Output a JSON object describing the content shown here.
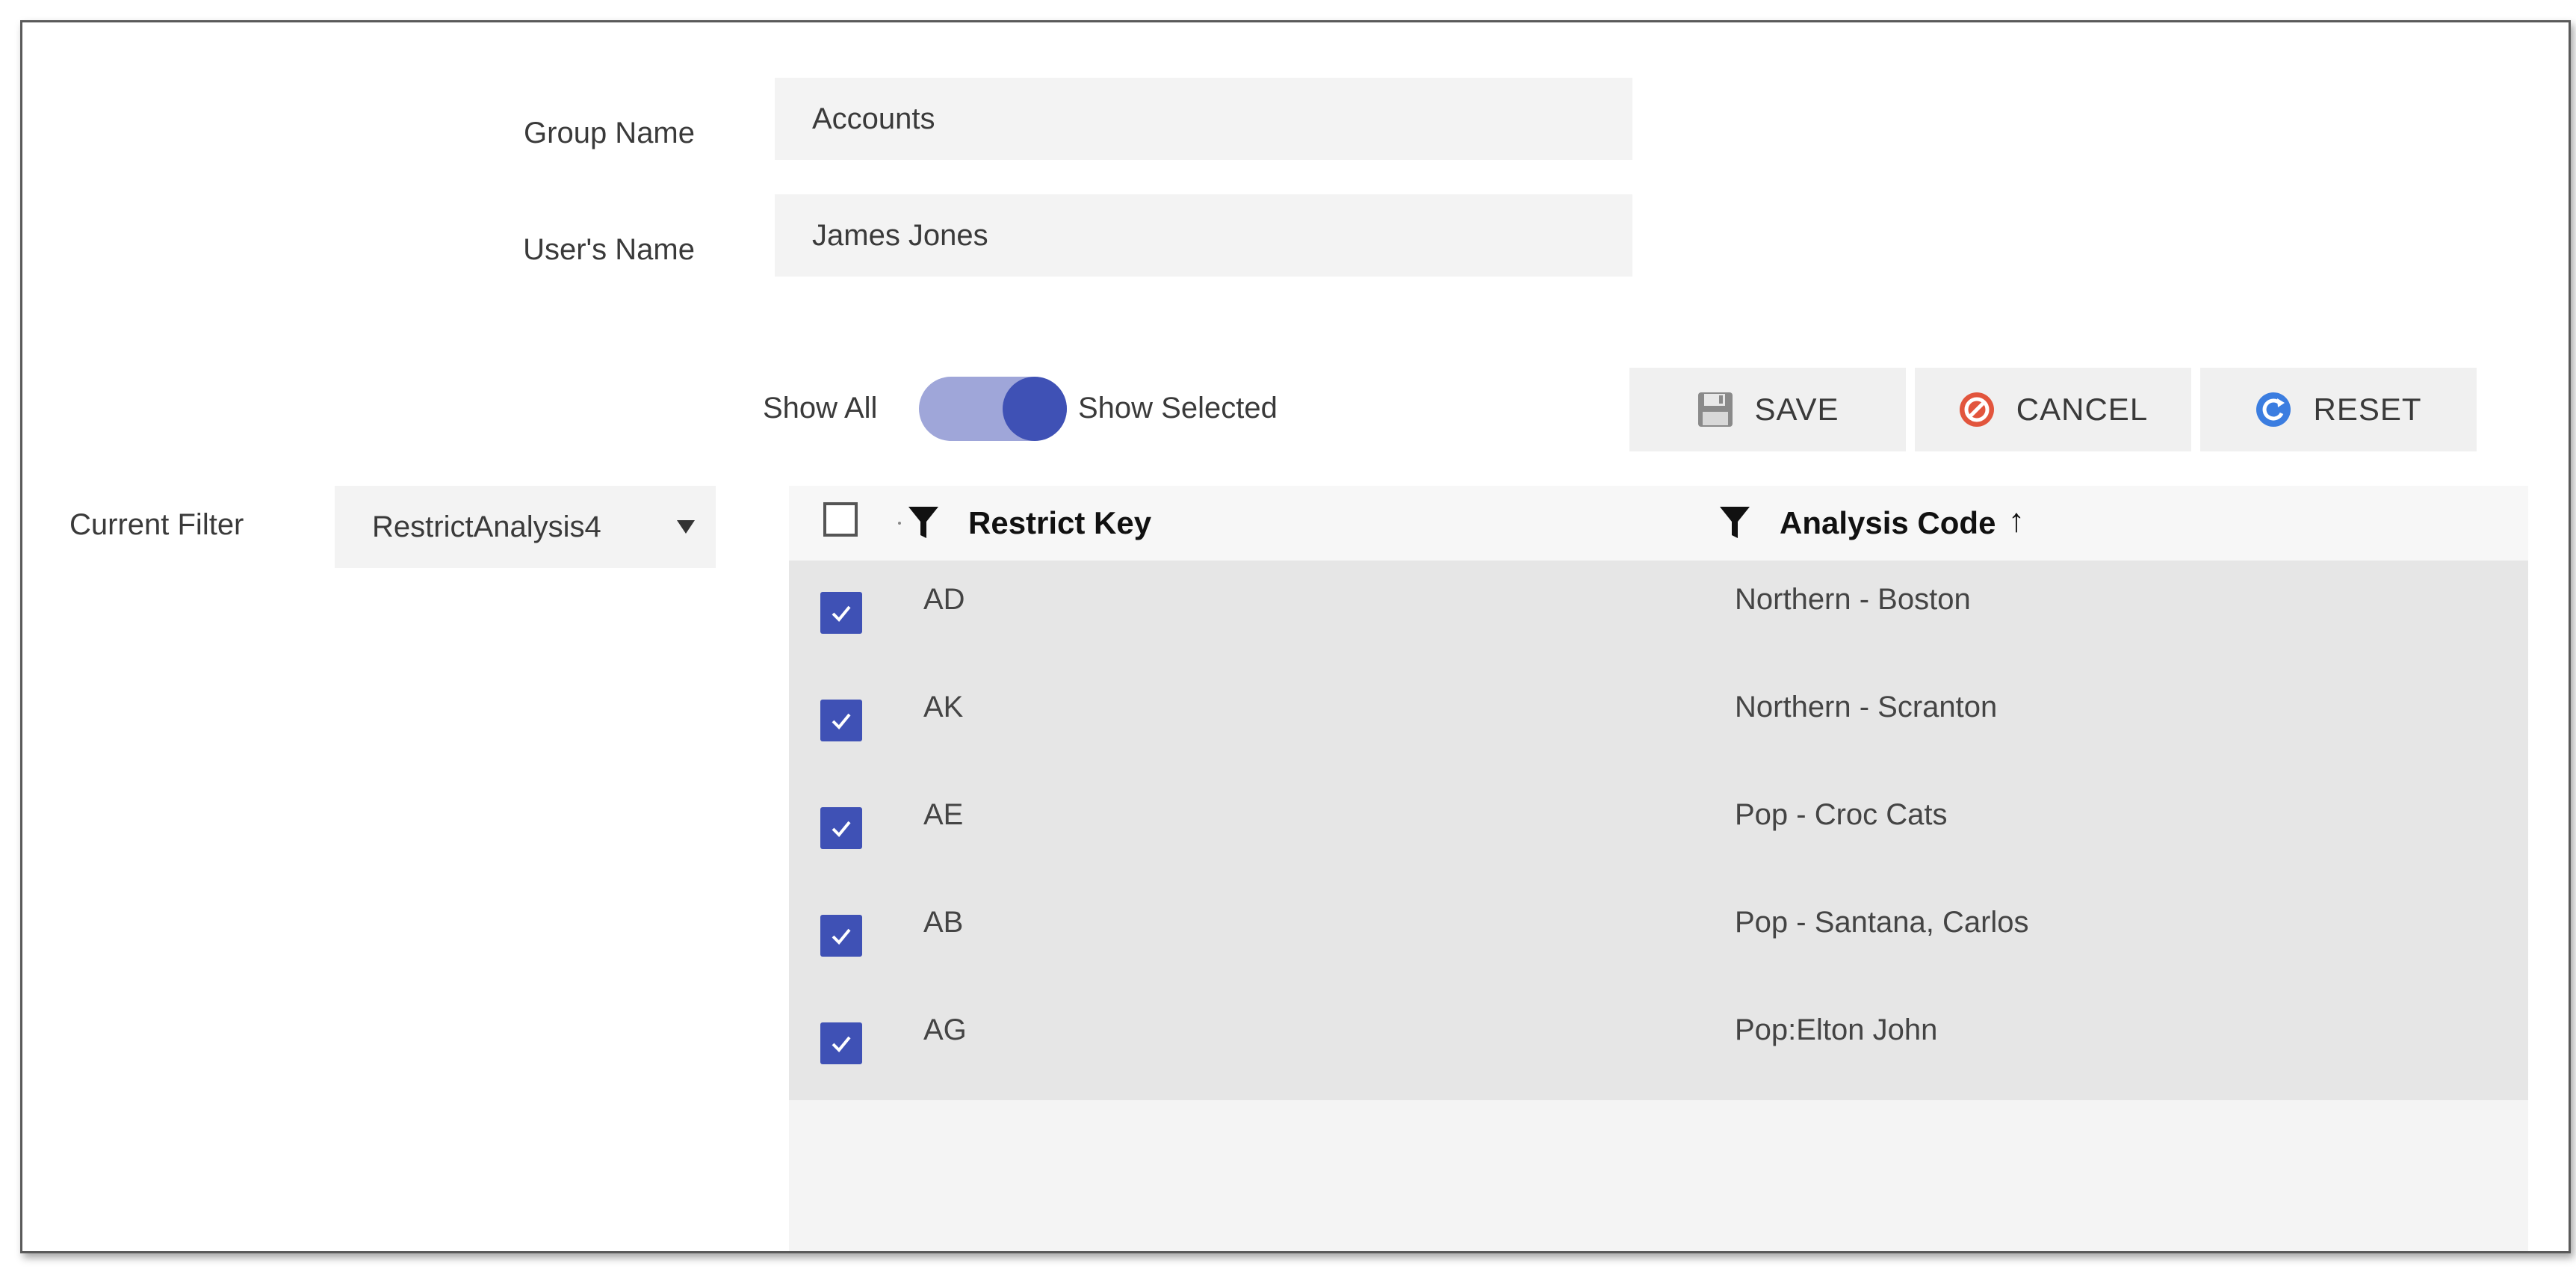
{
  "form": {
    "group_name_label": "Group Name",
    "group_name_value": "Accounts",
    "users_name_label": "User's Name",
    "users_name_value": "James Jones"
  },
  "toggle": {
    "left_label": "Show All",
    "right_label": "Show Selected",
    "state": "Show Selected"
  },
  "buttons": {
    "save_label": "SAVE",
    "cancel_label": "CANCEL",
    "reset_label": "RESET"
  },
  "filter": {
    "label": "Current Filter",
    "selected": "RestrictAnalysis4"
  },
  "grid": {
    "columns": [
      "Restrict Key",
      "Analysis Code"
    ],
    "sort": {
      "column": "Analysis Code",
      "direction": "ascending"
    },
    "rows": [
      {
        "checked": true,
        "key": "AD",
        "code": "Northern - Boston"
      },
      {
        "checked": true,
        "key": "AK",
        "code": "Northern - Scranton"
      },
      {
        "checked": true,
        "key": "AE",
        "code": "Pop - Croc Cats"
      },
      {
        "checked": true,
        "key": "AB",
        "code": "Pop - Santana, Carlos"
      },
      {
        "checked": true,
        "key": "AG",
        "code": "Pop:Elton John"
      }
    ]
  },
  "colors": {
    "accent": "#3f51b5",
    "toggle_track": "#9fa6d9",
    "field_bg": "#f3f3f3",
    "row_bg": "#e6e6e6"
  }
}
